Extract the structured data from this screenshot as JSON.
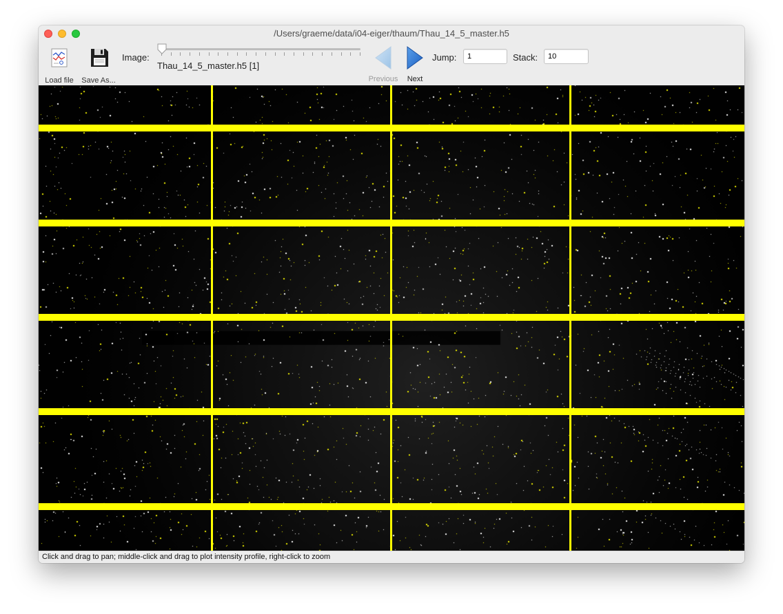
{
  "window": {
    "title": "/Users/graeme/data/i04-eiger/thaum/Thau_14_5_master.h5"
  },
  "toolbar": {
    "load_label": "Load file",
    "save_label": "Save As...",
    "image_label": "Image:",
    "image_name": "Thau_14_5_master.h5 [1]",
    "slider_position": 0,
    "previous_label": "Previous",
    "next_label": "Next",
    "jump_label": "Jump:",
    "jump_value": "1",
    "stack_label": "Stack:",
    "stack_value": "10"
  },
  "icons": {
    "load": "chart-file-icon",
    "save": "floppy-disk-icon",
    "previous": "left-triangle-icon",
    "next": "right-triangle-icon"
  },
  "detector": {
    "module_columns": 4,
    "module_rows": 6,
    "gap_color": "#ffff00",
    "background_color": "#000000"
  },
  "statusbar": {
    "text": "Click and drag to pan; middle-click and drag to plot intensity profile, right-click to zoom"
  }
}
